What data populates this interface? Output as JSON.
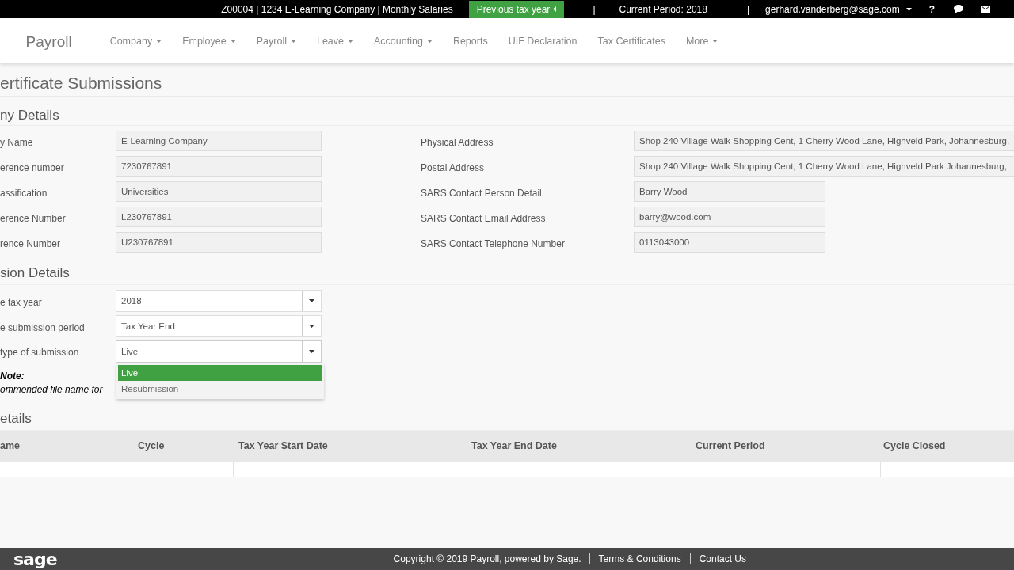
{
  "top_bar": {
    "context": "Z00004 | 1234 E-Learning Company | Monthly Salaries",
    "previous_button": "Previous tax year",
    "separators": [
      "|",
      "|"
    ],
    "current_period": "Current Period: 2018",
    "user": "gerhard.vanderberg@sage.com",
    "help": "?"
  },
  "nav": {
    "brand": "Payroll",
    "items": [
      {
        "label": "Company",
        "caret": true
      },
      {
        "label": "Employee",
        "caret": true
      },
      {
        "label": "Payroll",
        "caret": true
      },
      {
        "label": "Leave",
        "caret": true
      },
      {
        "label": "Accounting",
        "caret": true
      },
      {
        "label": "Reports",
        "caret": false
      },
      {
        "label": "UIF Declaration",
        "caret": false
      },
      {
        "label": "Tax Certificates",
        "caret": false
      },
      {
        "label": "More",
        "caret": true
      }
    ]
  },
  "page_title": "ertificate Submissions",
  "company_details": {
    "title": "ny Details",
    "left_fields": [
      {
        "label": "y Name",
        "value": "E-Learning Company"
      },
      {
        "label": "erence number",
        "value": "7230767891"
      },
      {
        "label": "assification",
        "value": "Universities"
      },
      {
        "label": "erence Number",
        "value": "L230767891"
      },
      {
        "label": "rence Number",
        "value": "U230767891"
      }
    ],
    "right_fields": [
      {
        "label": "Physical Address",
        "value": "Shop 240 Village Walk Shopping Cent, 1 Cherry Wood Lane, Highveld Park, Johannesburg,",
        "wide": true
      },
      {
        "label": "Postal Address",
        "value": "Shop 240 Village Walk Shopping Cent, 1 Cherry Wood Lane, Highveld Park Johannesburg,",
        "wide": true
      },
      {
        "label": "SARS Contact Person Detail",
        "value": "Barry Wood",
        "wide": false
      },
      {
        "label": "SARS Contact Email Address",
        "value": "barry@wood.com",
        "wide": false
      },
      {
        "label": "SARS Contact Telephone Number",
        "value": "0113043000",
        "wide": false
      }
    ]
  },
  "submission_details": {
    "title": "sion Details",
    "selects": [
      {
        "label": "e tax year",
        "value": "2018",
        "expanded": false
      },
      {
        "label": "e submission period",
        "value": "Tax Year End",
        "expanded": false
      },
      {
        "label": "type of submission",
        "value": "Live",
        "expanded": true
      }
    ],
    "options": [
      {
        "label": "Live",
        "selected": true
      },
      {
        "label": "Resubmission",
        "selected": false
      }
    ],
    "note": {
      "title": "Note:",
      "text": "ommended file name for"
    }
  },
  "details": {
    "title": "etails",
    "columns": [
      "ame",
      "Cycle",
      "Tax Year Start Date",
      "Tax Year End Date",
      "Current Period",
      "Cycle Closed"
    ]
  },
  "footer": {
    "logo": "sage",
    "copyright": "Copyright © 2019 Payroll, powered by Sage.",
    "links": [
      "Terms & Conditions",
      "Contact Us"
    ]
  }
}
